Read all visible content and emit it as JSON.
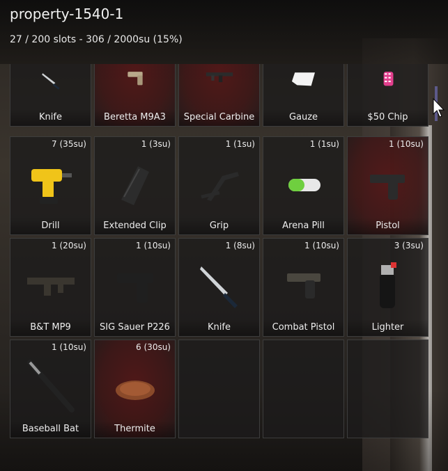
{
  "header": {
    "title": "property-1540-1",
    "capacity": "27 / 200 slots - 306 / 2000su (15%)"
  },
  "slots": [
    {
      "name": "Knife",
      "count": "",
      "icon": "knife-icon"
    },
    {
      "name": "Beretta M9A3",
      "count": "",
      "icon": "pistol-icon"
    },
    {
      "name": "Special Carbine",
      "count": "",
      "icon": "rifle-icon"
    },
    {
      "name": "Gauze",
      "count": "",
      "icon": "gauze-icon"
    },
    {
      "name": "$50 Chip",
      "count": "",
      "icon": "chip-icon"
    },
    {
      "name": "Drill",
      "count": "7 (35su)",
      "icon": "drill-icon"
    },
    {
      "name": "Extended Clip",
      "count": "1 (3su)",
      "icon": "magazine-icon"
    },
    {
      "name": "Grip",
      "count": "1 (1su)",
      "icon": "grip-icon"
    },
    {
      "name": "Arena Pill",
      "count": "1 (1su)",
      "icon": "pill-icon"
    },
    {
      "name": "Pistol",
      "count": "1 (10su)",
      "icon": "pistol-icon"
    },
    {
      "name": "B&T MP9",
      "count": "1 (20su)",
      "icon": "smg-icon"
    },
    {
      "name": "SIG Sauer P226",
      "count": "1 (10su)",
      "icon": "pistol-icon"
    },
    {
      "name": "Knife",
      "count": "1 (8su)",
      "icon": "knife-icon"
    },
    {
      "name": "Combat Pistol",
      "count": "1 (10su)",
      "icon": "pistol-icon"
    },
    {
      "name": "Lighter",
      "count": "3 (3su)",
      "icon": "lighter-icon"
    },
    {
      "name": "Baseball Bat",
      "count": "1 (10su)",
      "icon": "bat-icon"
    },
    {
      "name": "Thermite",
      "count": "6 (30su)",
      "icon": "thermite-icon"
    },
    {
      "name": "",
      "count": "",
      "icon": ""
    },
    {
      "name": "",
      "count": "",
      "icon": ""
    },
    {
      "name": "",
      "count": "",
      "icon": ""
    }
  ],
  "colors": {
    "slot_bg": "#1c1b1b",
    "slot_border": "#3d3d3d",
    "highlight_red": "#781414",
    "scrollbar": "#5d5a8a"
  }
}
